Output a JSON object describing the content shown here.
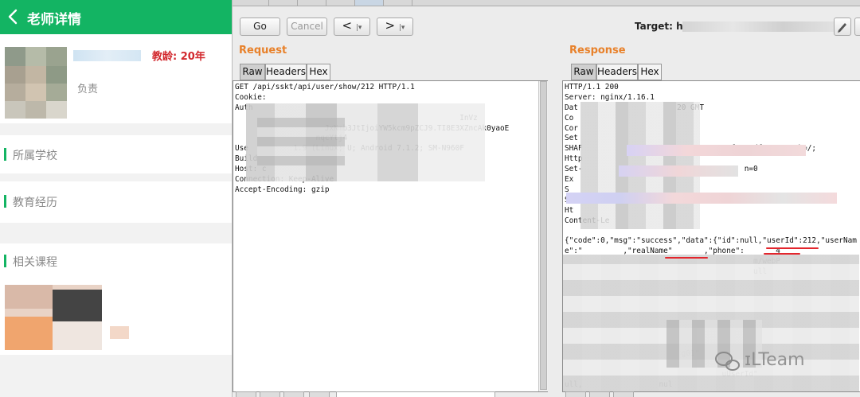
{
  "phone": {
    "header_title": "老师详情",
    "teaching_age": "教龄: 20年",
    "duty": "负责",
    "sections": [
      {
        "label": "所属学校"
      },
      {
        "label": "教育经历"
      },
      {
        "label": "相关课程"
      }
    ],
    "accent_color": "#13b463"
  },
  "burp": {
    "go_label": "Go",
    "cancel_label": "Cancel",
    "prev_label": "<",
    "next_label": ">",
    "dropdown_glyph": "|▾",
    "target_label": "Target: http:",
    "request_title": "Request",
    "response_title": "Response",
    "tabs": [
      "Raw",
      "Headers",
      "Hex"
    ],
    "title_color": "#e8812a",
    "request_lines": [
      "GET /api/sskt/api/user/show/212 HTTP/1.1",
      "Cookie:",
      "Auth",
      "                                                  InVz",
      "                    JxNmb3JtIjoiYW5kcm9pZCJ9.TI8E3XZncAk0yaoE",
      "                  nqcYtj4",
      "Use          1.9 (Linux; U; Android 7.1.2; SM-N960F",
      "Build",
      "Host: c",
      "Connection: Keep-Alive",
      "Accept-Encoding: gzip"
    ],
    "response_lines": [
      "HTTP/1.1 200",
      "Server: nginx/1.16.1",
      "Dat                      20 GMT",
      "Co",
      "Cor",
      "Set",
      "SHAF                              -eef26a1dfe92; Path=/;",
      "Http",
      "Set-                                    n=0",
      "Ex",
      "S",
      "S",
      "Ht",
      "Content-Le",
      "",
      "{\"code\":0,\"msg\":\"success\",\"data\":{\"id\":null,\"userId\":212,\"userNam",
      "e\":\"         ,\"realName\"       ,\"phone\":       4",
      "                                          m/webP",
      "                                          ull",
      "",
      "",
      "",
      "",
      "",
      "",
      "",
      "                          g01\"",
      "                                   ",
      "                                   uUserId\"",
      "ull,                 nul"
    ]
  },
  "watermark_text": "ɪLTeam"
}
